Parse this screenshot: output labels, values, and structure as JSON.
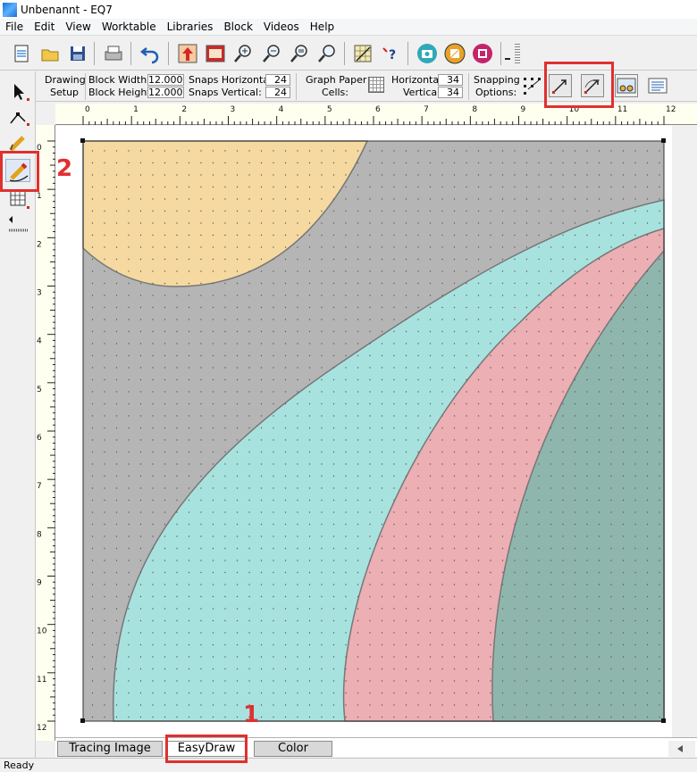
{
  "window": {
    "title": "Unbenannt - EQ7"
  },
  "menu": [
    "File",
    "Edit",
    "View",
    "Worktable",
    "Libraries",
    "Block",
    "Videos",
    "Help"
  ],
  "toolbar": {
    "icons": [
      "new-icon",
      "open-icon",
      "save-icon",
      "print-icon",
      "undo-icon",
      "add-to-sketchbook-icon",
      "view-sketchbook-icon",
      "zoom-in-icon",
      "zoom-out-icon",
      "zoom-fit-icon",
      "zoom-refresh-icon",
      "graph-paper-icon",
      "help-icon",
      "camera-icon",
      "easydraw-block-icon",
      "pieced-block-icon"
    ]
  },
  "options": {
    "drawing_setup_label1": "Drawing",
    "drawing_setup_label2": "Setup",
    "block_width_label": "Block Width:",
    "block_width_value": "12.000",
    "block_height_label": "Block Height:",
    "block_height_value": "12.000",
    "snaps_h_label": "Snaps Horizontal:",
    "snaps_h_value": "24",
    "snaps_v_label": "Snaps Vertical:",
    "snaps_v_value": "24",
    "graph_paper_label1": "Graph Paper",
    "graph_paper_label2": "Cells:",
    "horizontal_label": "Horizontal",
    "horizontal_value": "34",
    "vertical_label": "Vertical",
    "vertical_value": "34",
    "snapping_label1": "Snapping",
    "snapping_label2": "Options:"
  },
  "rulers": {
    "top": [
      "0",
      "1",
      "2",
      "3",
      "4",
      "5",
      "6",
      "7",
      "8",
      "9",
      "10",
      "11",
      "12"
    ],
    "left": [
      "0",
      "1",
      "2",
      "3",
      "4",
      "5",
      "6",
      "7",
      "8",
      "9",
      "10",
      "11",
      "12"
    ]
  },
  "colors": {
    "gray": "#b5b5b5",
    "yellow": "#f5d9a0",
    "teal": "#a8e2df",
    "pink": "#ebafb4",
    "dark_teal": "#8fb6ad",
    "annotation": "#e03030"
  },
  "tabs": [
    "Tracing Image",
    "EasyDraw",
    "Color"
  ],
  "active_tab": "EasyDraw",
  "annotations": {
    "label_1": "1",
    "label_2": "2"
  },
  "status": {
    "text": "Ready"
  }
}
